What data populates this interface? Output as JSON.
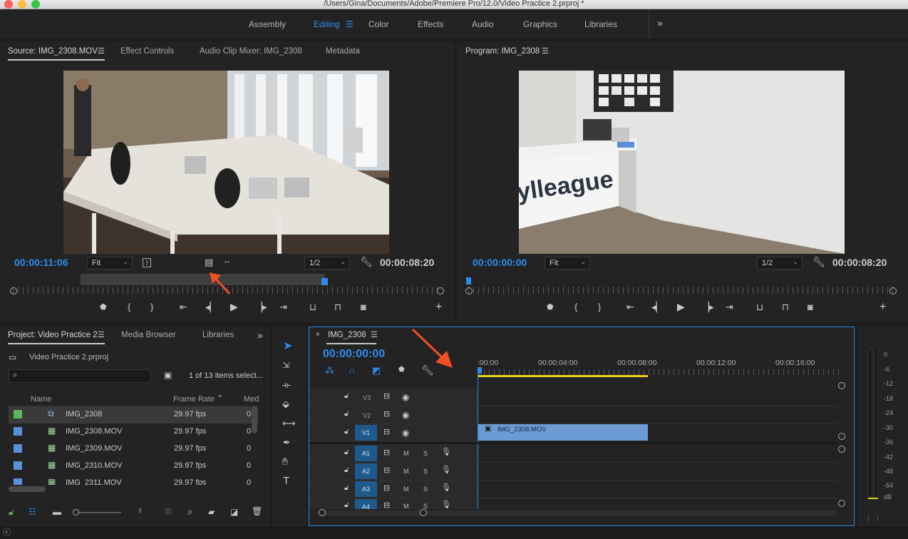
{
  "window": {
    "title": "/Users/Gina/Documents/Adobe/Premiere Pro/12.0/Video Practice 2.prproj *"
  },
  "workspaces": {
    "tabs": [
      "Assembly",
      "Editing",
      "Color",
      "Effects",
      "Audio",
      "Graphics",
      "Libraries"
    ],
    "active": "Editing",
    "more_icon": "double-chevron-right-icon"
  },
  "source_panel": {
    "tabs": [
      "Source: IMG_2308.MOV",
      "Effect Controls",
      "Audio Clip Mixer: IMG_2308",
      "Metadata"
    ],
    "timecode": "00:00:11:06",
    "fit": "Fit",
    "resolution": "1/2",
    "duration": "00:00:08:20"
  },
  "program_panel": {
    "title": "Program: IMG_2308",
    "timecode": "00:00:00:00",
    "fit": "Fit",
    "resolution": "1/2",
    "duration": "00:00:08:20",
    "banner_text": "ylleague"
  },
  "project_panel": {
    "tabs": [
      "Project: Video Practice 2",
      "Media Browser",
      "Libraries"
    ],
    "project_file": "Video Practice 2.prproj",
    "items_count": "1 of 13 items select...",
    "columns": [
      "Name",
      "Frame Rate",
      "Med"
    ],
    "rows": [
      {
        "name": "IMG_2308",
        "frame_rate": "29.97 fps",
        "media": "0",
        "color": "#5cb85c"
      },
      {
        "name": "IMG_2308.MOV",
        "frame_rate": "29.97 fps",
        "media": "0",
        "color": "#5b8fd6"
      },
      {
        "name": "IMG_2309.MOV",
        "frame_rate": "29.97 fps",
        "media": "0",
        "color": "#5b8fd6"
      },
      {
        "name": "IMG_2310.MOV",
        "frame_rate": "29.97 fps",
        "media": "0",
        "color": "#5b8fd6"
      },
      {
        "name": "IMG_2311.MOV",
        "frame_rate": "29.97 fps",
        "media": "0",
        "color": "#5b8fd6"
      }
    ]
  },
  "timeline": {
    "sequence": "IMG_2308",
    "timecode": "00:00:00:00",
    "ruler_labels": [
      ":00:00",
      "00:00:04:00",
      "00:00:08:00",
      "00:00:12:00",
      "00:00:16:00"
    ],
    "video_tracks": [
      "V3",
      "V2",
      "V1"
    ],
    "audio_tracks": [
      "A1",
      "A2",
      "A3",
      "A4"
    ],
    "track_buttons": [
      "M",
      "S"
    ],
    "clip_name": "IMG_2308.MOV"
  },
  "audio_meter": {
    "labels": [
      "0",
      "-6",
      "-12",
      "-18",
      "-24",
      "-30",
      "-36",
      "-42",
      "-48",
      "-54",
      "dB"
    ]
  },
  "colors": {
    "accent": "#2d8ceb",
    "clip": "#6b9bd2",
    "track_target": "#1f5a8c",
    "annotation_arrow": "#f04e23"
  }
}
